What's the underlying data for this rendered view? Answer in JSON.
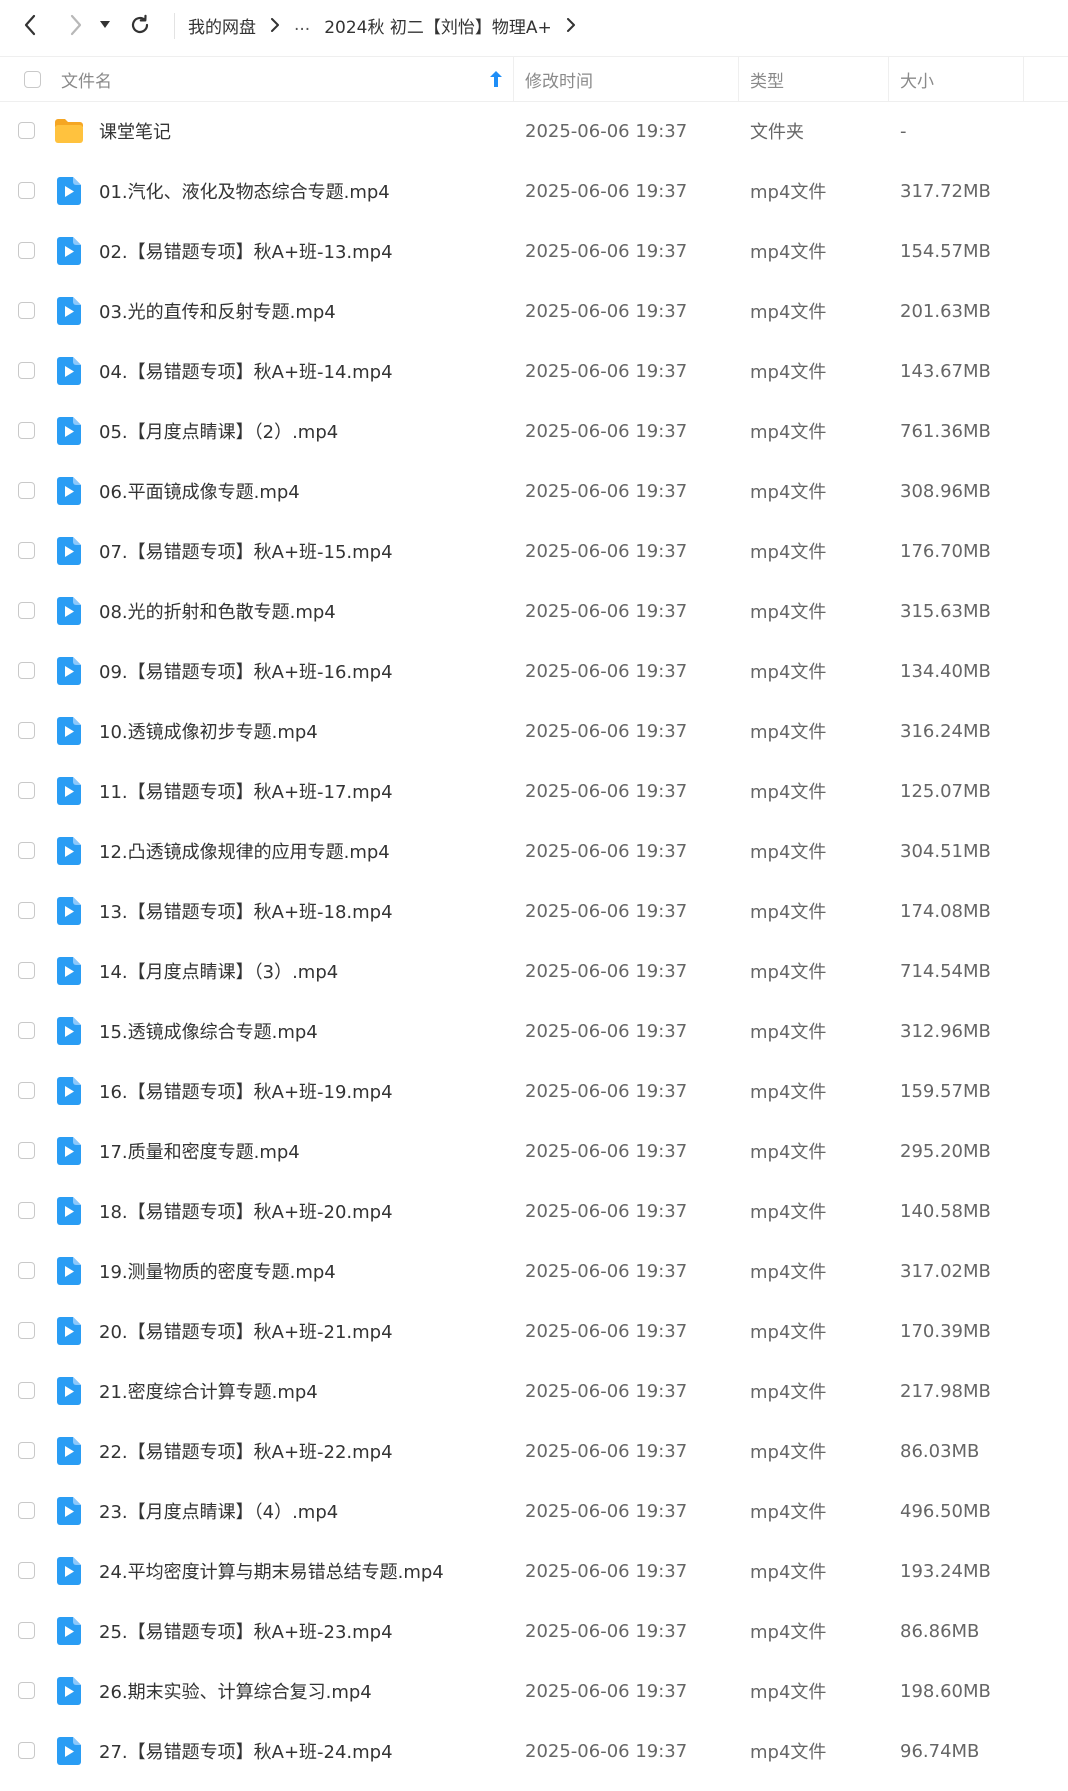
{
  "nav": {
    "breadcrumb": [
      "我的网盘",
      "...",
      "2024秋 初二【刘怡】物理A+"
    ]
  },
  "columns": {
    "name": "文件名",
    "modified": "修改时间",
    "type": "类型",
    "size": "大小"
  },
  "colors": {
    "accent": "#1e8ef7",
    "video_icon": "#2a9df4",
    "folder_icon": "#ffc23e"
  },
  "files": [
    {
      "icon": "folder-icon",
      "name": "课堂笔记",
      "modified": "2025-06-06 19:37",
      "type": "文件夹",
      "size": "-"
    },
    {
      "icon": "video-file-icon",
      "name": "01.汽化、液化及物态综合专题.mp4",
      "modified": "2025-06-06 19:37",
      "type": "mp4文件",
      "size": "317.72MB"
    },
    {
      "icon": "video-file-icon",
      "name": "02.【易错题专项】秋A+班-13.mp4",
      "modified": "2025-06-06 19:37",
      "type": "mp4文件",
      "size": "154.57MB"
    },
    {
      "icon": "video-file-icon",
      "name": "03.光的直传和反射专题.mp4",
      "modified": "2025-06-06 19:37",
      "type": "mp4文件",
      "size": "201.63MB"
    },
    {
      "icon": "video-file-icon",
      "name": "04.【易错题专项】秋A+班-14.mp4",
      "modified": "2025-06-06 19:37",
      "type": "mp4文件",
      "size": "143.67MB"
    },
    {
      "icon": "video-file-icon",
      "name": "05.【月度点睛课】（2）.mp4",
      "modified": "2025-06-06 19:37",
      "type": "mp4文件",
      "size": "761.36MB"
    },
    {
      "icon": "video-file-icon",
      "name": "06.平面镜成像专题.mp4",
      "modified": "2025-06-06 19:37",
      "type": "mp4文件",
      "size": "308.96MB"
    },
    {
      "icon": "video-file-icon",
      "name": "07.【易错题专项】秋A+班-15.mp4",
      "modified": "2025-06-06 19:37",
      "type": "mp4文件",
      "size": "176.70MB"
    },
    {
      "icon": "video-file-icon",
      "name": "08.光的折射和色散专题.mp4",
      "modified": "2025-06-06 19:37",
      "type": "mp4文件",
      "size": "315.63MB"
    },
    {
      "icon": "video-file-icon",
      "name": "09.【易错题专项】秋A+班-16.mp4",
      "modified": "2025-06-06 19:37",
      "type": "mp4文件",
      "size": "134.40MB"
    },
    {
      "icon": "video-file-icon",
      "name": "10.透镜成像初步专题.mp4",
      "modified": "2025-06-06 19:37",
      "type": "mp4文件",
      "size": "316.24MB"
    },
    {
      "icon": "video-file-icon",
      "name": "11.【易错题专项】秋A+班-17.mp4",
      "modified": "2025-06-06 19:37",
      "type": "mp4文件",
      "size": "125.07MB"
    },
    {
      "icon": "video-file-icon",
      "name": "12.凸透镜成像规律的应用专题.mp4",
      "modified": "2025-06-06 19:37",
      "type": "mp4文件",
      "size": "304.51MB"
    },
    {
      "icon": "video-file-icon",
      "name": "13.【易错题专项】秋A+班-18.mp4",
      "modified": "2025-06-06 19:37",
      "type": "mp4文件",
      "size": "174.08MB"
    },
    {
      "icon": "video-file-icon",
      "name": "14.【月度点睛课】（3）.mp4",
      "modified": "2025-06-06 19:37",
      "type": "mp4文件",
      "size": "714.54MB"
    },
    {
      "icon": "video-file-icon",
      "name": "15.透镜成像综合专题.mp4",
      "modified": "2025-06-06 19:37",
      "type": "mp4文件",
      "size": "312.96MB"
    },
    {
      "icon": "video-file-icon",
      "name": "16.【易错题专项】秋A+班-19.mp4",
      "modified": "2025-06-06 19:37",
      "type": "mp4文件",
      "size": "159.57MB"
    },
    {
      "icon": "video-file-icon",
      "name": "17.质量和密度专题.mp4",
      "modified": "2025-06-06 19:37",
      "type": "mp4文件",
      "size": "295.20MB"
    },
    {
      "icon": "video-file-icon",
      "name": "18.【易错题专项】秋A+班-20.mp4",
      "modified": "2025-06-06 19:37",
      "type": "mp4文件",
      "size": "140.58MB"
    },
    {
      "icon": "video-file-icon",
      "name": "19.测量物质的密度专题.mp4",
      "modified": "2025-06-06 19:37",
      "type": "mp4文件",
      "size": "317.02MB"
    },
    {
      "icon": "video-file-icon",
      "name": "20.【易错题专项】秋A+班-21.mp4",
      "modified": "2025-06-06 19:37",
      "type": "mp4文件",
      "size": "170.39MB"
    },
    {
      "icon": "video-file-icon",
      "name": "21.密度综合计算专题.mp4",
      "modified": "2025-06-06 19:37",
      "type": "mp4文件",
      "size": "217.98MB"
    },
    {
      "icon": "video-file-icon",
      "name": "22.【易错题专项】秋A+班-22.mp4",
      "modified": "2025-06-06 19:37",
      "type": "mp4文件",
      "size": "86.03MB"
    },
    {
      "icon": "video-file-icon",
      "name": "23.【月度点睛课】（4）.mp4",
      "modified": "2025-06-06 19:37",
      "type": "mp4文件",
      "size": "496.50MB"
    },
    {
      "icon": "video-file-icon",
      "name": "24.平均密度计算与期末易错总结专题.mp4",
      "modified": "2025-06-06 19:37",
      "type": "mp4文件",
      "size": "193.24MB"
    },
    {
      "icon": "video-file-icon",
      "name": "25.【易错题专项】秋A+班-23.mp4",
      "modified": "2025-06-06 19:37",
      "type": "mp4文件",
      "size": "86.86MB"
    },
    {
      "icon": "video-file-icon",
      "name": "26.期末实验、计算综合复习.mp4",
      "modified": "2025-06-06 19:37",
      "type": "mp4文件",
      "size": "198.60MB"
    },
    {
      "icon": "video-file-icon",
      "name": "27.【易错题专项】秋A+班-24.mp4",
      "modified": "2025-06-06 19:37",
      "type": "mp4文件",
      "size": "96.74MB"
    }
  ]
}
